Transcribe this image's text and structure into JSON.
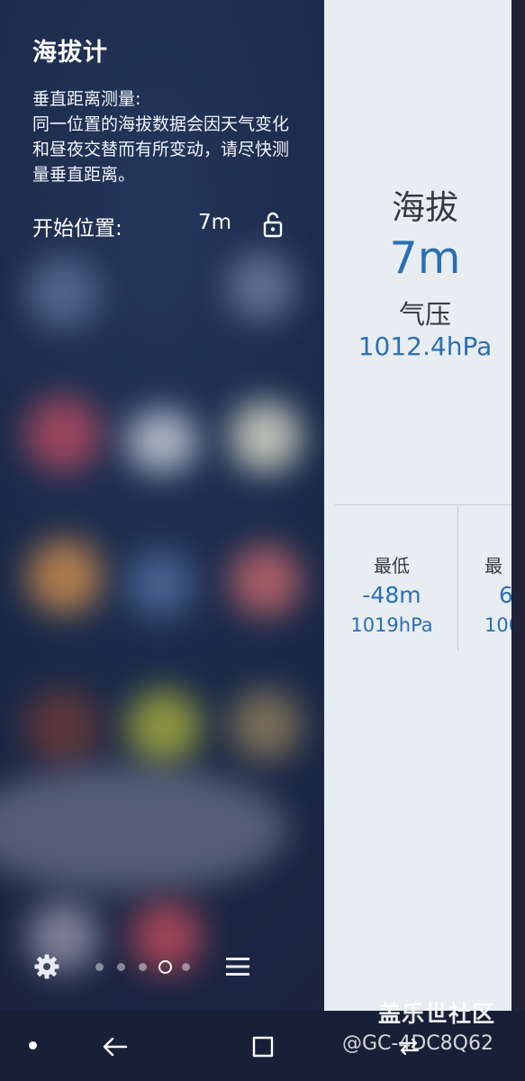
{
  "edge_panel": {
    "title": "海拔计",
    "description_heading": "垂直距离测量:",
    "description_body": "同一位置的海拔数据会因天气变化和昼夜交替而有所变动，请尽快测量垂直距离。",
    "start_label": "开始位置:",
    "start_value": "7m",
    "lock_icon": "unlocked-padlock-icon",
    "settings_icon": "gear-icon",
    "menu_icon": "hamburger-menu-icon",
    "page_count": 5,
    "active_page_index": 3
  },
  "altimeter_card": {
    "altitude_label": "海拔",
    "altitude_value": "7m",
    "pressure_label": "气压",
    "pressure_value": "1012.4hPa",
    "stats": [
      {
        "title": "最低",
        "altitude": "-48m",
        "pressure": "1019hPa"
      },
      {
        "title": "最",
        "altitude": "6",
        "pressure": "100"
      }
    ]
  },
  "nav_bar": {
    "icons": [
      "dot-icon",
      "back-icon",
      "recents-icon",
      "home-icon"
    ]
  },
  "watermark": {
    "title": "盖乐世社区",
    "id": "@GC-4DC8Q62"
  },
  "colors": {
    "accent_blue": "#2b6fb3",
    "card_bg": "#e8edf2",
    "nav_bg": "#172036"
  }
}
